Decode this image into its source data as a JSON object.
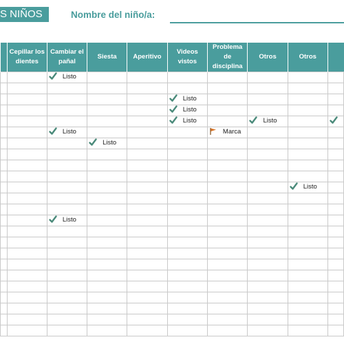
{
  "header": {
    "title": "S NIÑOS",
    "child_label": "Nombre del niño/a:",
    "child_value": ""
  },
  "table": {
    "columns": [
      "",
      "Cepillar los dientes",
      "Cambiar el pañal",
      "Siesta",
      "Aperitivo",
      "Videos vistos",
      "Problema de disciplina",
      "Otros",
      "Otros",
      ""
    ],
    "rows": [
      [
        "",
        "",
        "check:Listo",
        "",
        "",
        "",
        "",
        "",
        "",
        ""
      ],
      [
        "",
        "",
        "",
        "",
        "",
        "",
        "",
        "",
        "",
        ""
      ],
      [
        "",
        "",
        "",
        "",
        "",
        "check:Listo",
        "",
        "",
        "",
        ""
      ],
      [
        "",
        "",
        "",
        "",
        "",
        "check:Listo",
        "",
        "",
        "",
        ""
      ],
      [
        "",
        "",
        "",
        "",
        "",
        "check:Listo",
        "",
        "check:Listo",
        "",
        "check:"
      ],
      [
        "",
        "",
        "check:Listo",
        "",
        "",
        "",
        "flag:Marca",
        "",
        "",
        ""
      ],
      [
        "",
        "",
        "",
        "check:Listo",
        "",
        "",
        "",
        "",
        "",
        ""
      ],
      [
        "",
        "",
        "",
        "",
        "",
        "",
        "",
        "",
        "",
        ""
      ],
      [
        "",
        "",
        "",
        "",
        "",
        "",
        "",
        "",
        "",
        ""
      ],
      [
        "",
        "",
        "",
        "",
        "",
        "",
        "",
        "",
        "",
        ""
      ],
      [
        "",
        "",
        "",
        "",
        "",
        "",
        "",
        "",
        "check:Listo",
        ""
      ],
      [
        "",
        "",
        "",
        "",
        "",
        "",
        "",
        "",
        "",
        ""
      ],
      [
        "",
        "",
        "",
        "",
        "",
        "",
        "",
        "",
        "",
        ""
      ],
      [
        "",
        "",
        "check:Listo",
        "",
        "",
        "",
        "",
        "",
        "",
        ""
      ],
      [
        "",
        "",
        "",
        "",
        "",
        "",
        "",
        "",
        "",
        ""
      ],
      [
        "",
        "",
        "",
        "",
        "",
        "",
        "",
        "",
        "",
        ""
      ],
      [
        "",
        "",
        "",
        "",
        "",
        "",
        "",
        "",
        "",
        ""
      ],
      [
        "",
        "",
        "",
        "",
        "",
        "",
        "",
        "",
        "",
        ""
      ],
      [
        "",
        "",
        "",
        "",
        "",
        "",
        "",
        "",
        "",
        ""
      ],
      [
        "",
        "",
        "",
        "",
        "",
        "",
        "",
        "",
        "",
        ""
      ],
      [
        "",
        "",
        "",
        "",
        "",
        "",
        "",
        "",
        "",
        ""
      ],
      [
        "",
        "",
        "",
        "",
        "",
        "",
        "",
        "",
        "",
        ""
      ],
      [
        "",
        "",
        "",
        "",
        "",
        "",
        "",
        "",
        "",
        ""
      ],
      [
        "",
        "",
        "",
        "",
        "",
        "",
        "",
        "",
        "",
        ""
      ]
    ]
  },
  "colors": {
    "accent": "#4a9d9d",
    "check": "#4a8a7a",
    "flag": "#d9772b",
    "gridline": "#c9c9c9"
  },
  "icons": {
    "check": "check-icon",
    "flag": "flag-icon"
  }
}
